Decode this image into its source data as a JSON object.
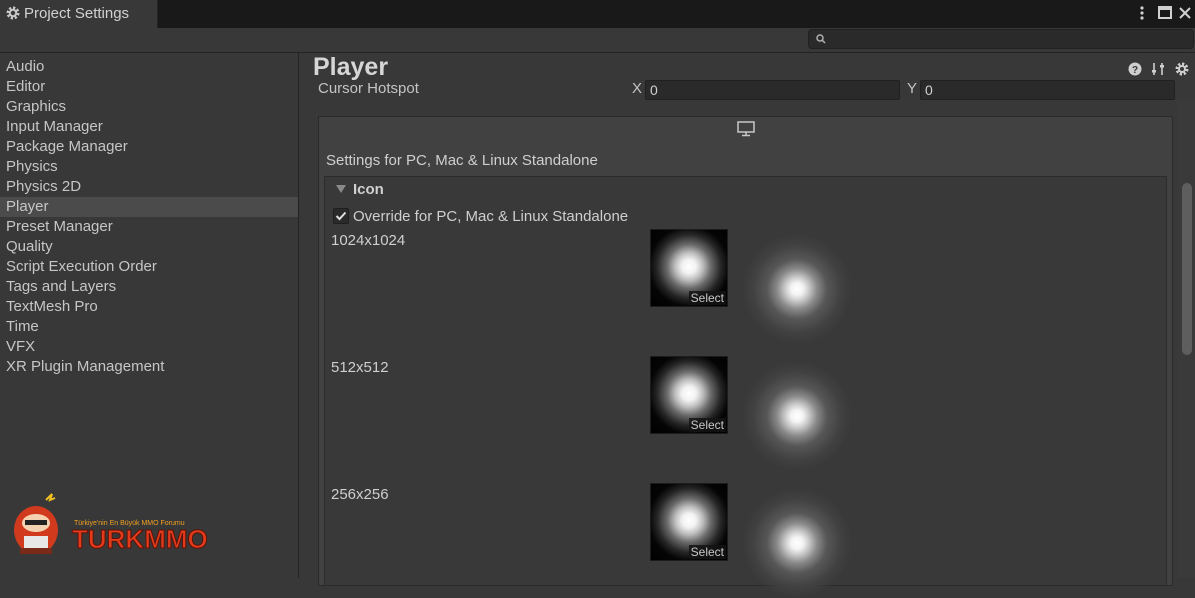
{
  "window": {
    "tab_title": "Project Settings"
  },
  "search": {
    "placeholder": ""
  },
  "sidebar": {
    "items": [
      {
        "label": "Audio"
      },
      {
        "label": "Editor"
      },
      {
        "label": "Graphics"
      },
      {
        "label": "Input Manager"
      },
      {
        "label": "Package Manager"
      },
      {
        "label": "Physics"
      },
      {
        "label": "Physics 2D"
      },
      {
        "label": "Player",
        "selected": true
      },
      {
        "label": "Preset Manager"
      },
      {
        "label": "Quality"
      },
      {
        "label": "Script Execution Order"
      },
      {
        "label": "Tags and Layers"
      },
      {
        "label": "TextMesh Pro"
      },
      {
        "label": "Time"
      },
      {
        "label": "VFX"
      },
      {
        "label": "XR Plugin Management"
      }
    ]
  },
  "logo": {
    "tagline": "Türkiye'nin En Büyük MMO Forumu",
    "name": "TURKMMO"
  },
  "main": {
    "title": "Player",
    "cursor_hotspot": {
      "label": "Cursor Hotspot",
      "x_label": "X",
      "x_value": "0",
      "y_label": "Y",
      "y_value": "0"
    },
    "platform_icon": "monitor-icon",
    "settings_for": "Settings for PC, Mac & Linux Standalone",
    "icon_section": {
      "label": "Icon",
      "override_label": "Override for PC, Mac & Linux Standalone",
      "override_checked": true,
      "sizes": [
        {
          "label": "1024x1024",
          "select_label": "Select"
        },
        {
          "label": "512x512",
          "select_label": "Select"
        },
        {
          "label": "256x256",
          "select_label": "Select"
        }
      ]
    }
  },
  "colors": {
    "background": "#383838",
    "titlebar": "#191919",
    "selected_item": "#4b4b4b",
    "field": "#2a2a2a"
  }
}
